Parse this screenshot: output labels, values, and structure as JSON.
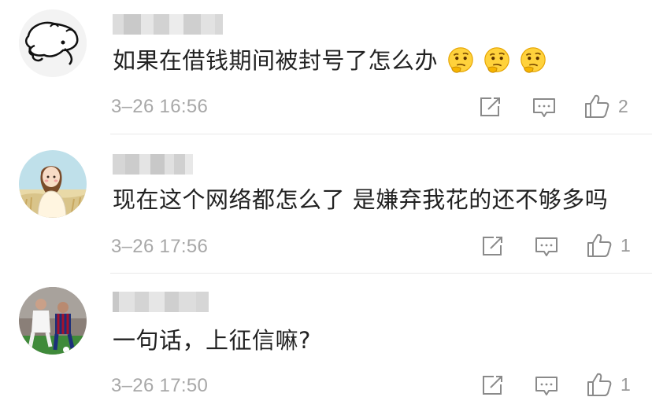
{
  "comments": [
    {
      "text": "如果在借钱期间被封号了怎么办",
      "emoji_count": 3,
      "time": "3–26 16:56",
      "likes": "2",
      "avatar": "cartoon-doodle-avatar"
    },
    {
      "text": "现在这个网络都怎么了 是嫌弃我花的还不够多吗",
      "time": "3–26 17:56",
      "likes": "1",
      "avatar": "illustrated-girl-avatar"
    },
    {
      "text": "一句话，上征信嘛?",
      "time": "3–26 17:50",
      "likes": "1",
      "avatar": "football-players-avatar"
    }
  ],
  "icons": {
    "share": "share-icon",
    "reply": "reply-comment-icon",
    "like": "thumbs-up-icon",
    "emoji": "thinking-face-emoji"
  },
  "colors": {
    "text": "#222222",
    "meta": "#a8a8a8",
    "divider": "#e9e9e9"
  }
}
